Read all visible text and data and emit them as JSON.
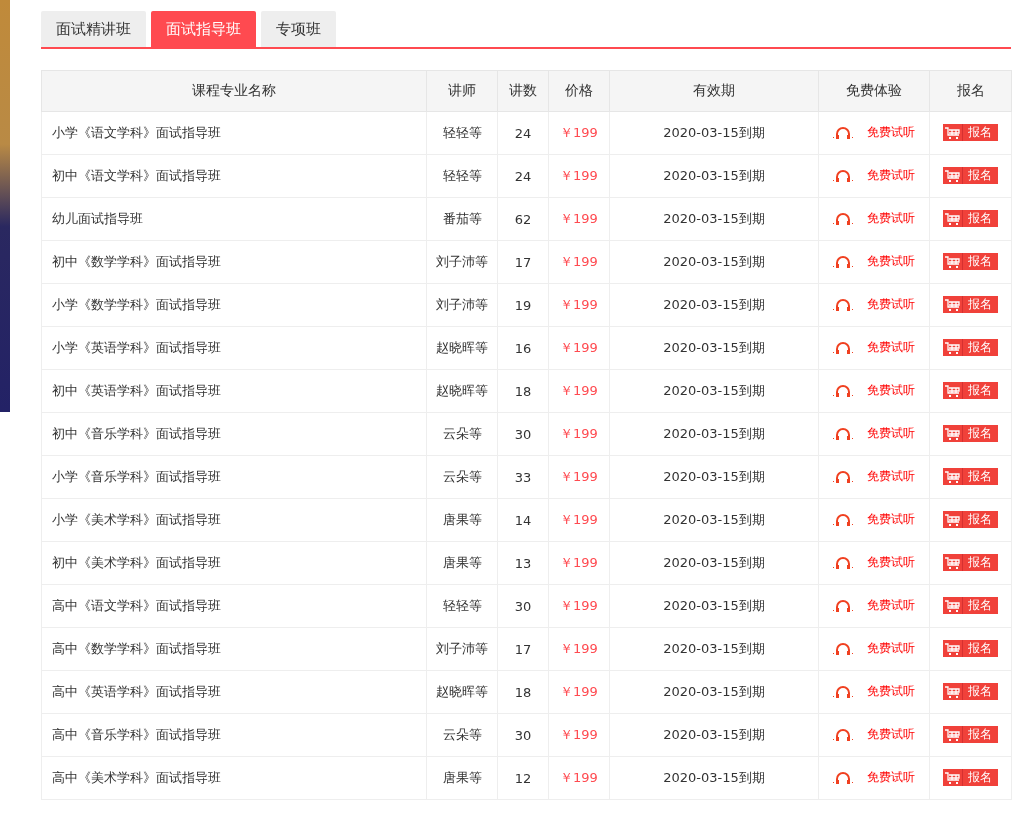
{
  "tabs": [
    {
      "label": "面试精讲班",
      "selected": false
    },
    {
      "label": "面试指导班",
      "selected": true
    },
    {
      "label": "专项班",
      "selected": false
    }
  ],
  "table": {
    "columns": [
      "课程专业名称",
      "讲师",
      "讲数",
      "价格",
      "有效期",
      "免费体验",
      "报名"
    ],
    "rows": [
      {
        "name": "小学《语文学科》面试指导班",
        "teacher": "轻轻等",
        "lectures": "24",
        "price": "￥199",
        "validity": "2020-03-15到期",
        "trial": "免费试听",
        "signup": "报名"
      },
      {
        "name": "初中《语文学科》面试指导班",
        "teacher": "轻轻等",
        "lectures": "24",
        "price": "￥199",
        "validity": "2020-03-15到期",
        "trial": "免费试听",
        "signup": "报名"
      },
      {
        "name": "幼儿面试指导班",
        "teacher": "番茄等",
        "lectures": "62",
        "price": "￥199",
        "validity": "2020-03-15到期",
        "trial": "免费试听",
        "signup": "报名"
      },
      {
        "name": "初中《数学学科》面试指导班",
        "teacher": "刘子沛等",
        "lectures": "17",
        "price": "￥199",
        "validity": "2020-03-15到期",
        "trial": "免费试听",
        "signup": "报名"
      },
      {
        "name": "小学《数学学科》面试指导班",
        "teacher": "刘子沛等",
        "lectures": "19",
        "price": "￥199",
        "validity": "2020-03-15到期",
        "trial": "免费试听",
        "signup": "报名"
      },
      {
        "name": "小学《英语学科》面试指导班",
        "teacher": "赵晓晖等",
        "lectures": "16",
        "price": "￥199",
        "validity": "2020-03-15到期",
        "trial": "免费试听",
        "signup": "报名"
      },
      {
        "name": "初中《英语学科》面试指导班",
        "teacher": "赵晓晖等",
        "lectures": "18",
        "price": "￥199",
        "validity": "2020-03-15到期",
        "trial": "免费试听",
        "signup": "报名"
      },
      {
        "name": "初中《音乐学科》面试指导班",
        "teacher": "云朵等",
        "lectures": "30",
        "price": "￥199",
        "validity": "2020-03-15到期",
        "trial": "免费试听",
        "signup": "报名"
      },
      {
        "name": "小学《音乐学科》面试指导班",
        "teacher": "云朵等",
        "lectures": "33",
        "price": "￥199",
        "validity": "2020-03-15到期",
        "trial": "免费试听",
        "signup": "报名"
      },
      {
        "name": "小学《美术学科》面试指导班",
        "teacher": "唐果等",
        "lectures": "14",
        "price": "￥199",
        "validity": "2020-03-15到期",
        "trial": "免费试听",
        "signup": "报名"
      },
      {
        "name": "初中《美术学科》面试指导班",
        "teacher": "唐果等",
        "lectures": "13",
        "price": "￥199",
        "validity": "2020-03-15到期",
        "trial": "免费试听",
        "signup": "报名"
      },
      {
        "name": "高中《语文学科》面试指导班",
        "teacher": "轻轻等",
        "lectures": "30",
        "price": "￥199",
        "validity": "2020-03-15到期",
        "trial": "免费试听",
        "signup": "报名"
      },
      {
        "name": "高中《数学学科》面试指导班",
        "teacher": "刘子沛等",
        "lectures": "17",
        "price": "￥199",
        "validity": "2020-03-15到期",
        "trial": "免费试听",
        "signup": "报名"
      },
      {
        "name": "高中《英语学科》面试指导班",
        "teacher": "赵晓晖等",
        "lectures": "18",
        "price": "￥199",
        "validity": "2020-03-15到期",
        "trial": "免费试听",
        "signup": "报名"
      },
      {
        "name": "高中《音乐学科》面试指导班",
        "teacher": "云朵等",
        "lectures": "30",
        "price": "￥199",
        "validity": "2020-03-15到期",
        "trial": "免费试听",
        "signup": "报名"
      },
      {
        "name": "高中《美术学科》面试指导班",
        "teacher": "唐果等",
        "lectures": "12",
        "price": "￥199",
        "validity": "2020-03-15到期",
        "trial": "免费试听",
        "signup": "报名"
      }
    ]
  }
}
